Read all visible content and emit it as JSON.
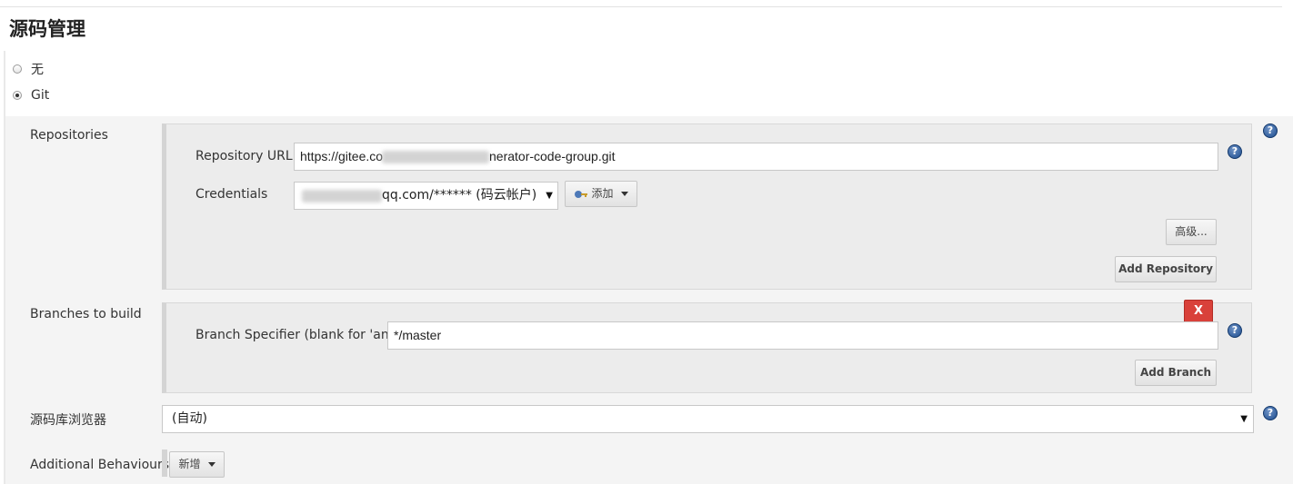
{
  "section": {
    "title": "源码管理"
  },
  "scm_options": [
    {
      "label": "无",
      "selected": false
    },
    {
      "label": "Git",
      "selected": true
    }
  ],
  "repositories": {
    "label": "Repositories",
    "url_label": "Repository URL",
    "url_value_start": "https://gitee.co",
    "url_value_end": "nerator-code-group.git",
    "credentials_label": "Credentials",
    "credentials_value": "qq.com/****** (码云帐户)",
    "add_button": "添加",
    "advanced_button": "高级...",
    "add_repository_button": "Add Repository"
  },
  "branches": {
    "label": "Branches to build",
    "delete_button": "X",
    "specifier_label": "Branch Specifier (blank for 'any')",
    "specifier_value": "*/master",
    "add_branch_button": "Add Branch"
  },
  "browser": {
    "label": "源码库浏览器",
    "value": "(自动)"
  },
  "additional_behaviours": {
    "label": "Additional Behaviours",
    "add_button": "新增"
  },
  "help_icon_glyph": "?",
  "colors": {
    "panel_bg": "#f4f4f4",
    "inner_box_bg": "#ececec",
    "delete_red": "#d9413a",
    "help_blue": "#1d4d8f"
  }
}
